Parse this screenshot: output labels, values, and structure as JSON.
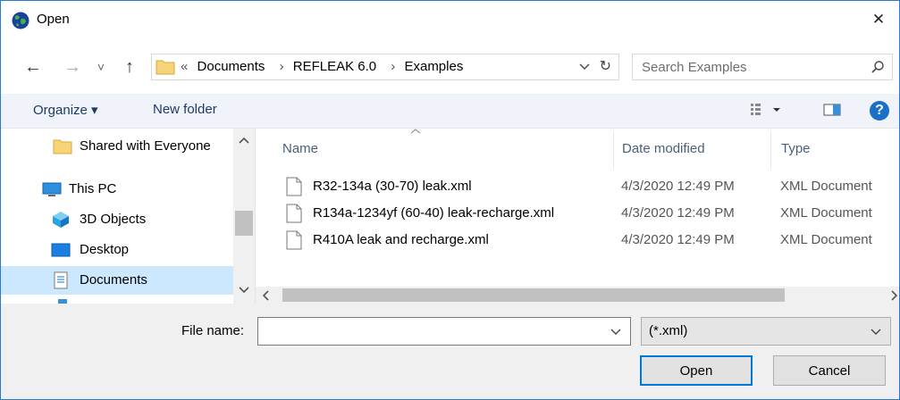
{
  "window": {
    "title": "Open",
    "close_glyph": "✕"
  },
  "nav": {
    "back_glyph": "←",
    "forward_glyph": "→",
    "recent_glyph": "˅",
    "up_glyph": "↑",
    "overflow": "«",
    "breadcrumbs": [
      "Documents",
      "REFLEAK 6.0",
      "Examples"
    ],
    "separator": "›",
    "refresh_glyph": "↻"
  },
  "search": {
    "placeholder": "Search Examples"
  },
  "toolbar": {
    "organize_label": "Organize ▾",
    "new_folder_label": "New folder",
    "help_glyph": "?"
  },
  "tree": {
    "items": [
      {
        "label": "Shared with Everyone",
        "icon": "folder-icon"
      },
      {
        "label": "This PC",
        "icon": "computer-icon"
      },
      {
        "label": "3D Objects",
        "icon": "3d-objects-icon"
      },
      {
        "label": "Desktop",
        "icon": "desktop-icon"
      },
      {
        "label": "Documents",
        "icon": "documents-icon",
        "selected": true
      }
    ]
  },
  "files": {
    "columns": {
      "name": "Name",
      "date": "Date modified",
      "type": "Type"
    },
    "rows": [
      {
        "name": "R32-134a (30-70) leak.xml",
        "date": "4/3/2020 12:49 PM",
        "type": "XML Document"
      },
      {
        "name": "R134a-1234yf (60-40) leak-recharge.xml",
        "date": "4/3/2020 12:49 PM",
        "type": "XML Document"
      },
      {
        "name": "R410A leak and recharge.xml",
        "date": "4/3/2020 12:49 PM",
        "type": "XML Document"
      }
    ]
  },
  "bottom": {
    "filename_label": "File name:",
    "filename_value": "",
    "filetype_value": "(*.xml)",
    "open_label": "Open",
    "cancel_label": "Cancel"
  },
  "colors": {
    "accent": "#0078d7",
    "toolbar_bg": "#f0f3f9",
    "selected_bg": "#cce8ff",
    "help_blue": "#1a6fc9"
  }
}
